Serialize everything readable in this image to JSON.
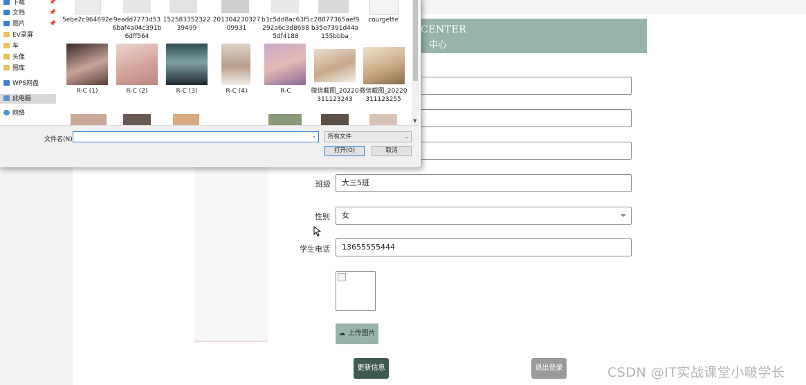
{
  "web": {
    "banner_title": "CENTER",
    "banner_subtitle": "中心",
    "fields": [
      {
        "label": "",
        "value": ""
      },
      {
        "label": "",
        "value": ""
      },
      {
        "label": "",
        "value": ""
      },
      {
        "label": "班级",
        "value": "大三5班"
      },
      {
        "label": "性别",
        "value": "女"
      },
      {
        "label": "学生电话",
        "value": "13655555444"
      }
    ],
    "upload_label": "上传图片",
    "update_button": "更新信息",
    "logout_button": "退出登录",
    "watermark": "CSDN @IT实战课堂小啵学长",
    "colors": {
      "accent": "#96b4a8",
      "primary_button": "#3e5a50",
      "secondary_button": "#9a9a9a"
    }
  },
  "dialog": {
    "nav": [
      {
        "label": "下载",
        "icon": "download-icon",
        "pinned": true
      },
      {
        "label": "文档",
        "icon": "document-icon",
        "pinned": true
      },
      {
        "label": "图片",
        "icon": "picture-icon",
        "pinned": true
      },
      {
        "label": "EV录屏",
        "icon": "folder-icon",
        "pinned": false
      },
      {
        "label": "车",
        "icon": "folder-icon",
        "pinned": false
      },
      {
        "label": "头像",
        "icon": "folder-icon",
        "pinned": false
      },
      {
        "label": "图库",
        "icon": "folder-icon",
        "pinned": false
      },
      {
        "label": "WPS网盘",
        "icon": "cloud-icon",
        "pinned": false
      },
      {
        "label": "此电脑",
        "icon": "computer-icon",
        "pinned": false,
        "selected": true
      },
      {
        "label": "网络",
        "icon": "network-icon",
        "pinned": false
      }
    ],
    "files_row1": [
      "5ebe2c964692e",
      "9eadd7273d536baf4a04c391b6dff564",
      "15258335232239499",
      "20130423032709931",
      "b3c5dd8ac63f5292a6c3d86885df4188",
      "c28877365aef9b35e7391d44a155bbba",
      "courgette"
    ],
    "files_row2": [
      "R-C (1)",
      "R-C (2)",
      "R-C (3)",
      "R-C (4)",
      "R-C",
      "微信截图_20220311123243",
      "微信截图_20220311123255"
    ],
    "filename_label": "文件名(N):",
    "filename_value": "",
    "filetype": "所有文件",
    "open_button": "打开(O)",
    "cancel_button": "取消"
  }
}
